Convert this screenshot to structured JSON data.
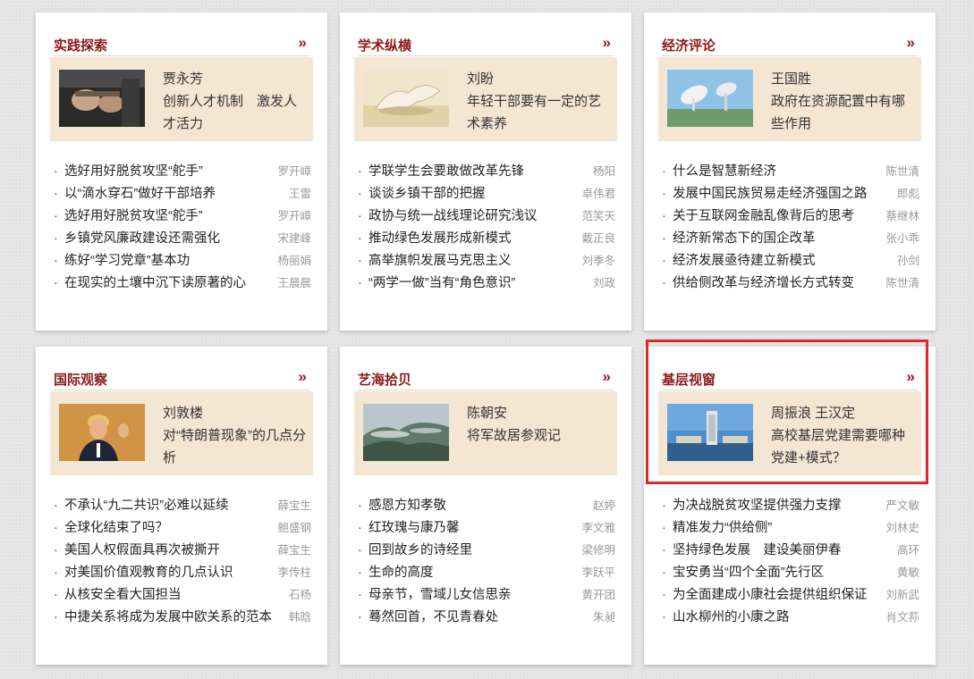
{
  "cards": [
    {
      "title": "实践探索",
      "more_icon": "»",
      "thumb": "hands-photo",
      "feature_author": "贾永芳",
      "feature_title": "创新人才机制　激发人才活力",
      "items": [
        {
          "title": "选好用好脱贫攻坚“舵手”",
          "author": "罗开嶂"
        },
        {
          "title": "以“滴水穿石”做好干部培养",
          "author": "王雷"
        },
        {
          "title": "选好用好脱贫攻坚“舵手”",
          "author": "罗开嶂"
        },
        {
          "title": "乡镇党风廉政建设还需强化",
          "author": "宋建峰"
        },
        {
          "title": "练好“学习党章”基本功",
          "author": "杨丽娟"
        },
        {
          "title": "在现实的土壤中沉下读原著的心",
          "author": "王晨晨"
        }
      ]
    },
    {
      "title": "学术纵横",
      "more_icon": "»",
      "thumb": "sculpture-photo",
      "feature_author": "刘盼",
      "feature_title": "年轻干部要有一定的艺术素养",
      "items": [
        {
          "title": "学联学生会要敢做改革先锋",
          "author": "杨阳"
        },
        {
          "title": "谈谈乡镇干部的把握",
          "author": "卓伟君"
        },
        {
          "title": "政协与统一战线理论研究浅议",
          "author": "范笑天"
        },
        {
          "title": "推动绿色发展形成新模式",
          "author": "戴正良"
        },
        {
          "title": "高举旗帜发展马克思主义",
          "author": "刘季冬"
        },
        {
          "title": "“两学一做”当有“角色意识”",
          "author": "刘政"
        }
      ]
    },
    {
      "title": "经济评论",
      "more_icon": "»",
      "thumb": "satellite-dish-photo",
      "feature_author": "王国胜",
      "feature_title": "政府在资源配置中有哪些作用",
      "items": [
        {
          "title": "什么是智慧新经济",
          "author": "陈世清"
        },
        {
          "title": "发展中国民族贸易走经济强国之路",
          "author": "郎彪"
        },
        {
          "title": "关于互联网金融乱像背后的思考",
          "author": "蔡继林"
        },
        {
          "title": "经济新常态下的国企改革",
          "author": "张小乖"
        },
        {
          "title": "经济发展亟待建立新模式",
          "author": "孙剑"
        },
        {
          "title": "供给侧改革与经济增长方式转变",
          "author": "陈世清"
        }
      ]
    },
    {
      "title": "国际观察",
      "more_icon": "»",
      "thumb": "portrait-photo",
      "feature_author": "刘敦楼",
      "feature_title": "对“特朗普现象”的几点分析",
      "items": [
        {
          "title": "不承认“九二共识”必难以延续",
          "author": "薛宝生"
        },
        {
          "title": "全球化结束了吗？",
          "author": "鲍盛钢"
        },
        {
          "title": "美国人权假面具再次被撕开",
          "author": "薛宝生"
        },
        {
          "title": "对美国价值观教育的几点认识",
          "author": "李传柱"
        },
        {
          "title": "从核安全看大国担当",
          "author": "石杨"
        },
        {
          "title": "中捷关系将成为发展中欧关系的范本",
          "author": "韩晗"
        }
      ]
    },
    {
      "title": "艺海拾贝",
      "more_icon": "»",
      "thumb": "mountain-landscape-photo",
      "feature_author": "陈朝安",
      "feature_title": "将军故居参观记",
      "items": [
        {
          "title": "感恩方知孝敬",
          "author": "赵婷"
        },
        {
          "title": "红玫瑰与康乃馨",
          "author": "李文雅"
        },
        {
          "title": "回到故乡的诗经里",
          "author": "梁修明"
        },
        {
          "title": "生命的高度",
          "author": "李跃平"
        },
        {
          "title": "母亲节，雪域儿女信思亲",
          "author": "黄开团"
        },
        {
          "title": "蓦然回首，不见青春处",
          "author": "朱昶"
        }
      ]
    },
    {
      "title": "基层视窗",
      "more_icon": "»",
      "thumb": "campus-tower-photo",
      "feature_author": "周振浪 王汉定",
      "feature_title": "高校基层党建需要哪种党建+模式？",
      "items": [
        {
          "title": "为决战脱贫攻坚提供强力支撑",
          "author": "严文敏"
        },
        {
          "title": "精准发力“供给侧”",
          "author": "刘林史"
        },
        {
          "title": "坚持绿色发展　建设美丽伊春",
          "author": "高环"
        },
        {
          "title": "宝安勇当“四个全面”先行区",
          "author": "黄敏"
        },
        {
          "title": "为全面建成小康社会提供组织保证",
          "author": "刘新武"
        },
        {
          "title": "山水柳州的小康之路",
          "author": "肖文荪"
        }
      ]
    }
  ],
  "colors": {
    "title_red": "#8b1a1a",
    "feature_bg": "#f3e6d2",
    "highlight_border": "#e3252a"
  }
}
